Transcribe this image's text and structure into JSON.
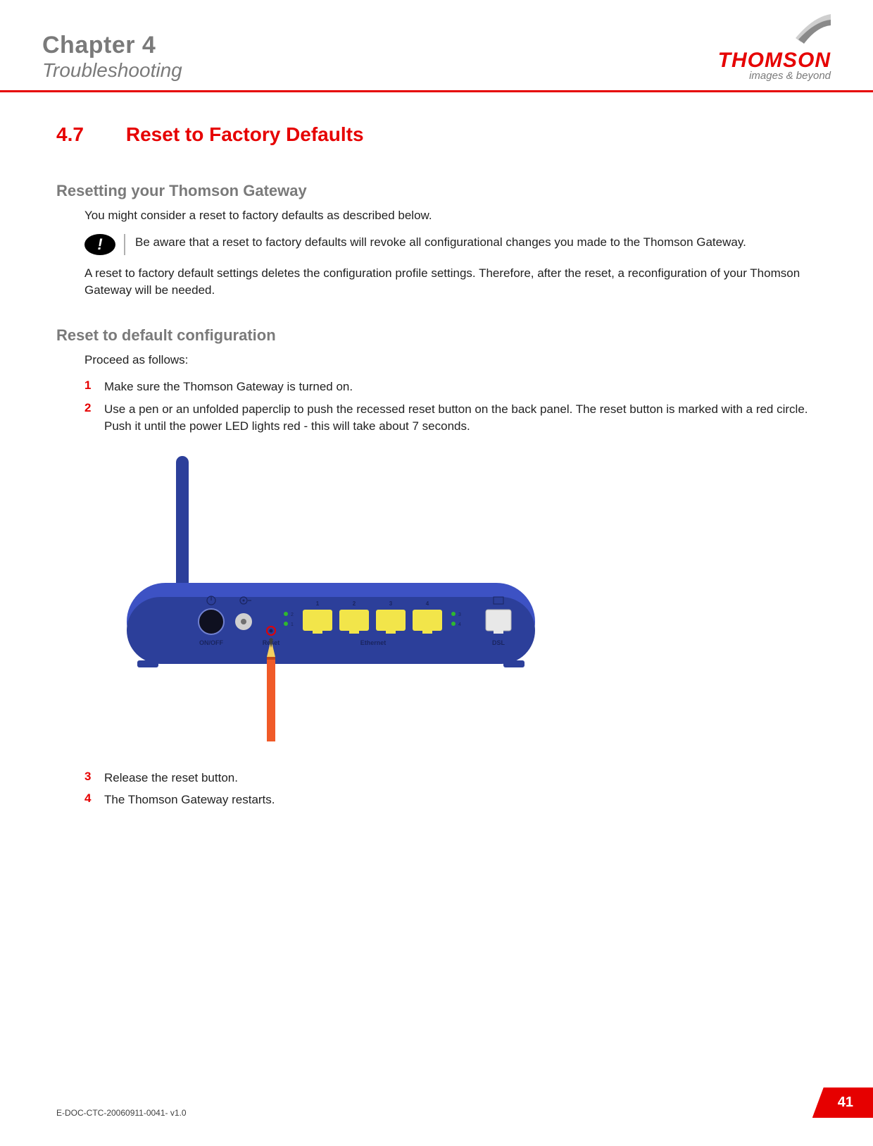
{
  "header": {
    "chapter": "Chapter 4",
    "subtitle": "Troubleshooting",
    "brand": "THOMSON",
    "tagline": "images & beyond"
  },
  "section": {
    "number": "4.7",
    "title": "Reset to Factory Defaults"
  },
  "sub1": {
    "heading": "Resetting your Thomson Gateway",
    "intro": "You might consider a reset to factory defaults as described below.",
    "callout": "Be aware that a reset to factory defaults will revoke all configurational changes you made to the Thomson Gateway.",
    "after": "A reset to factory default settings deletes the configuration profile settings. Therefore, after the reset, a reconfiguration of your Thomson Gateway will be needed."
  },
  "sub2": {
    "heading": "Reset to default configuration",
    "intro": "Proceed as follows:",
    "steps": [
      "Make sure the Thomson Gateway is turned on.",
      "Use a pen or an unfolded paperclip to push the recessed reset button on the back panel. The reset button is marked with a red circle. Push it until the power LED lights red - this will take about 7 seconds.",
      "Release the reset button.",
      "The Thomson Gateway restarts."
    ]
  },
  "router": {
    "labels": {
      "onoff": "ON/OFF",
      "reset": "Reset",
      "ethernet": "Ethernet",
      "dsl": "DSL",
      "ports": [
        "1",
        "2",
        "3",
        "4"
      ],
      "ledpairs": [
        "2",
        "1",
        "3",
        "4"
      ]
    }
  },
  "footer": {
    "doc": "E-DOC-CTC-20060911-0041- v1.0",
    "page": "41"
  }
}
